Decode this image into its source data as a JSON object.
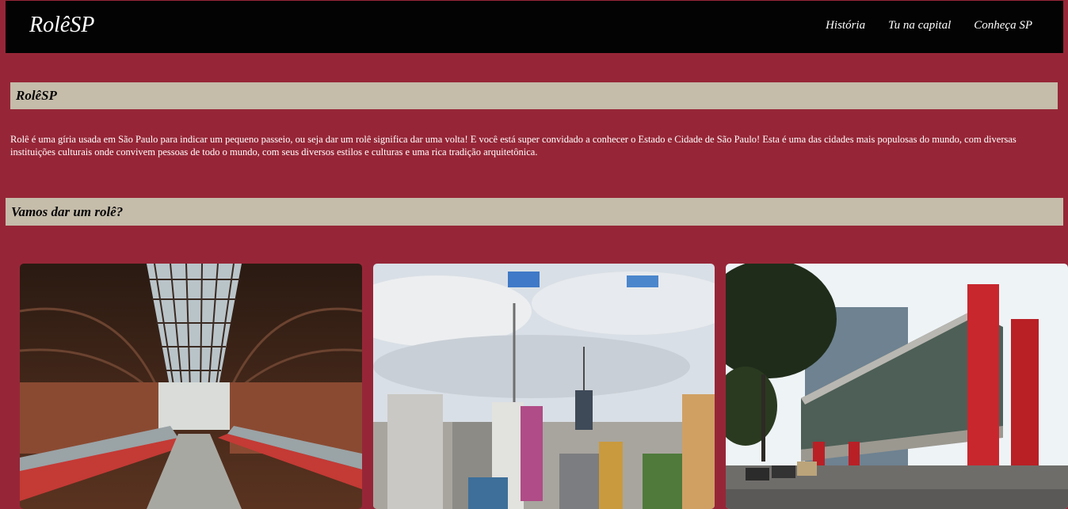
{
  "nav": {
    "brand": "RolêSP",
    "links": [
      "História",
      "Tu na capital",
      "Conheça SP"
    ]
  },
  "section1": {
    "heading": "RolêSP",
    "text": "Rolê é uma gíria usada em São Paulo para indicar um pequeno passeio, ou seja dar um rolê significa dar uma volta! E você está super convidado a conhecer o Estado e Cidade de São Paulo! Esta é uma das cidades mais populosas do mundo, com diversas instituições culturais onde convivem pessoas de todo o mundo, com seus diversos estilos e culturas e uma rica tradição arquitetônica."
  },
  "section2": {
    "heading": "Vamos dar um rolê?"
  },
  "cards": [
    {
      "image": "train-station-photo"
    },
    {
      "image": "city-skyline-photo"
    },
    {
      "image": "museum-building-photo"
    }
  ],
  "colors": {
    "background": "#962637",
    "navbar": "#030303",
    "section_bar": "#c5bcaa",
    "text": "#ffffff"
  }
}
